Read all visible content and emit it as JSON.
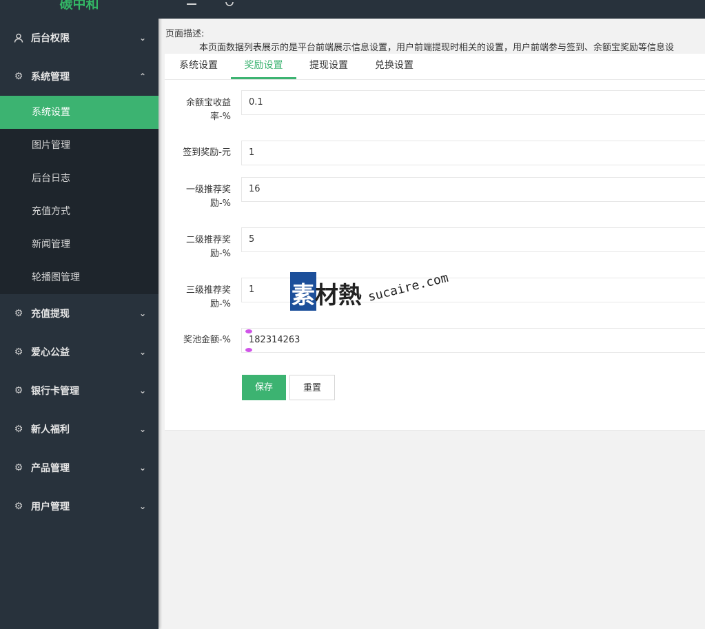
{
  "app": {
    "logo": "碳中和"
  },
  "topbar": {
    "menu_icon": "hamburger-icon",
    "refresh_icon": "refresh-icon"
  },
  "sidebar": {
    "groups_top": [
      {
        "label": "后台权限",
        "icon": "user-icon",
        "state": "collapsed"
      },
      {
        "label": "系统管理",
        "icon": "gear-icon",
        "state": "expanded"
      }
    ],
    "sub_items": [
      {
        "label": "系统设置",
        "active": true
      },
      {
        "label": "图片管理"
      },
      {
        "label": "后台日志"
      },
      {
        "label": "充值方式"
      },
      {
        "label": "新闻管理"
      },
      {
        "label": "轮播图管理"
      }
    ],
    "groups_bottom": [
      {
        "label": "充值提现",
        "icon": "gear-icon"
      },
      {
        "label": "爱心公益",
        "icon": "gear-icon"
      },
      {
        "label": "银行卡管理",
        "icon": "gear-icon"
      },
      {
        "label": "新人福利",
        "icon": "gear-icon"
      },
      {
        "label": "产品管理",
        "icon": "gear-icon"
      },
      {
        "label": "用户管理",
        "icon": "gear-icon"
      }
    ]
  },
  "page": {
    "desc_label": "页面描述:",
    "desc_text": "本页面数据列表展示的是平台前端展示信息设置，用户前端提现时相关的设置，用户前端参与签到、余额宝奖励等信息设"
  },
  "tabs": [
    {
      "label": "系统设置"
    },
    {
      "label": "奖励设置",
      "active": true
    },
    {
      "label": "提现设置"
    },
    {
      "label": "兑换设置"
    }
  ],
  "form": {
    "fields": [
      {
        "label_line1": "余额宝收益",
        "label_line2": "率-%",
        "value": "0.1"
      },
      {
        "label_line1": "签到奖励-元",
        "label_line2": "",
        "value": "1"
      },
      {
        "label_line1": "一级推荐奖",
        "label_line2": "励-%",
        "value": "16"
      },
      {
        "label_line1": "二级推荐奖",
        "label_line2": "励-%",
        "value": "5"
      },
      {
        "label_line1": "三级推荐奖",
        "label_line2": "励-%",
        "value": "1"
      },
      {
        "label_line1": "奖池金额-%",
        "label_line2": "",
        "value": "182314263"
      }
    ],
    "save_label": "保存",
    "reset_label": "重置"
  },
  "watermark": {
    "cn": "素材熱",
    "en": "sucaire.com"
  },
  "colors": {
    "accent": "#3cb371",
    "sidebar_bg": "#28323c",
    "submenu_bg": "#1e252c"
  }
}
